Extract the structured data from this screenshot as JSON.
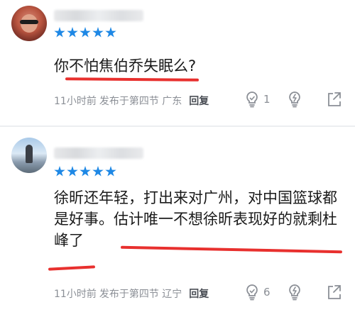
{
  "comments": [
    {
      "text_lines": [
        "你不怕焦伯乔失眠么?"
      ],
      "time": "11小时前",
      "publish_prefix": "发布于",
      "location": "第四节 广东",
      "reply_label": "回复",
      "likes": "1",
      "rating_stars": 5
    },
    {
      "text_lines": [
        "徐昕还年轻，打出来对广州，对中国篮球都",
        "是好事。估计唯一不想徐昕表现好的就剩杜",
        "峰了"
      ],
      "time": "11小时前",
      "publish_prefix": "发布于",
      "location": "第四节 辽宁",
      "reply_label": "回复",
      "likes": "6",
      "rating_stars": 5
    }
  ],
  "colors": {
    "star": "#1e88e5",
    "underline": "#e8302e",
    "meta_text": "#8b8f96"
  },
  "icons": {
    "like": "thumbs-up-bulb-icon",
    "dislike": "thumbs-down-bulb-icon",
    "share": "share-arrow-icon"
  }
}
